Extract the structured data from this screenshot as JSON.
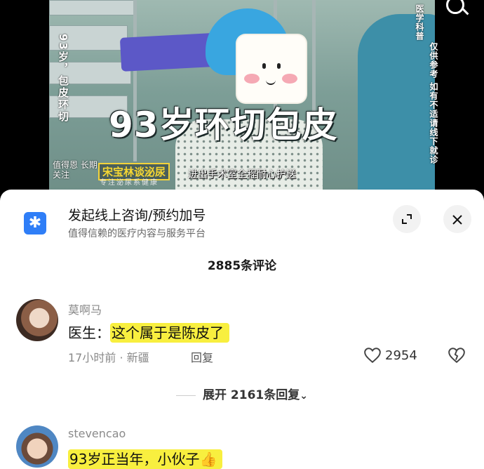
{
  "video": {
    "title_overlay": "93岁环切包皮",
    "vertical_left": "93岁，包皮环切",
    "vertical_right_1": "医学科普",
    "vertical_right_2": "仅供参考 如有不适请线下就诊",
    "brand": "值得恩 长期关注",
    "host": "宋宝林谈泌尿",
    "host_sub": "专注泌尿系健康",
    "caption": "进出手术室全程耐心护送",
    "search_icon": "search-icon"
  },
  "consult": {
    "logo_icon": "asterisk-icon",
    "title": "发起线上咨询/预约加号",
    "subtitle": "值得信赖的医疗内容与服务平台",
    "expand_icon": "expand-icon",
    "close_icon": "close-icon"
  },
  "comments_header": "2885条评论",
  "comments": [
    {
      "username": "莫啊马",
      "text": "医生：这个属于是陈皮了",
      "text_prefix": "医生：",
      "text_highlight": "这个属于是陈皮了",
      "meta": "17小时前 · 新疆",
      "reply": "回复",
      "likes": "2954"
    },
    {
      "username": "stevencao",
      "text_highlight": "93岁正当年，小伙子",
      "emoji": "👍"
    }
  ],
  "expand_replies": "展开 2161条回复",
  "colors": {
    "highlight": "#f8ef3f",
    "logo_blue": "#2f7ef7",
    "muted": "#8a8a8a"
  }
}
